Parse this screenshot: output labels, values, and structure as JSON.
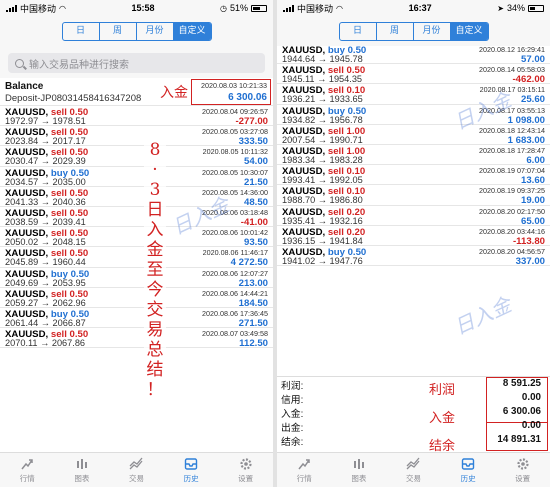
{
  "status_left": {
    "carrier": "中国移动",
    "time": "15:58",
    "battery": "51%",
    "battery_pct": 0.51
  },
  "status_right": {
    "carrier": "中国移动",
    "time": "16:37",
    "battery": "34%",
    "battery_pct": 0.34
  },
  "segments": [
    "日",
    "周",
    "月份",
    "自定义"
  ],
  "active_segment": 3,
  "search_placeholder": "输入交易品种进行搜索",
  "balance": {
    "title": "Balance",
    "deposit_id": "Deposit-JP08031458416347208",
    "datetime": "2020.08.03 10:21:33",
    "amount": "6 300.06"
  },
  "annotations": {
    "deposit": "入金",
    "vertical": [
      "8",
      "·",
      "3",
      "日",
      "入",
      "金",
      "至",
      "今",
      "交",
      "易",
      "总",
      "结",
      "！"
    ],
    "profit": "利润",
    "deposit2": "入金",
    "balance": "结余"
  },
  "left_trades": [
    {
      "symbol": "XAUUSD,",
      "side": "sell",
      "lots": "0.50",
      "open": "1972.97",
      "close": "1978.51",
      "datetime": "2020.08.04 09:26:57",
      "profit": "-277.00"
    },
    {
      "symbol": "XAUUSD,",
      "side": "sell",
      "lots": "0.50",
      "open": "2023.84",
      "close": "2017.17",
      "datetime": "2020.08.05 03:27:08",
      "profit": "333.50"
    },
    {
      "symbol": "XAUUSD,",
      "side": "sell",
      "lots": "0.50",
      "open": "2030.47",
      "close": "2029.39",
      "datetime": "2020.08.05 10:11:32",
      "profit": "54.00"
    },
    {
      "symbol": "XAUUSD,",
      "side": "buy",
      "lots": "0.50",
      "open": "2034.57",
      "close": "2035.00",
      "datetime": "2020.08.05 10:30:07",
      "profit": "21.50"
    },
    {
      "symbol": "XAUUSD,",
      "side": "sell",
      "lots": "0.50",
      "open": "2041.33",
      "close": "2040.36",
      "datetime": "2020.08.05 14:36:00",
      "profit": "48.50"
    },
    {
      "symbol": "XAUUSD,",
      "side": "sell",
      "lots": "0.50",
      "open": "2038.59",
      "close": "2039.41",
      "datetime": "2020.08.06 03:18:48",
      "profit": "-41.00"
    },
    {
      "symbol": "XAUUSD,",
      "side": "sell",
      "lots": "0.50",
      "open": "2050.02",
      "close": "2048.15",
      "datetime": "2020.08.06 10:01:42",
      "profit": "93.50"
    },
    {
      "symbol": "XAUUSD,",
      "side": "sell",
      "lots": "0.50",
      "open": "2045.89",
      "close": "1960.44",
      "datetime": "2020.08.06 11:46:17",
      "profit": "4 272.50"
    },
    {
      "symbol": "XAUUSD,",
      "side": "buy",
      "lots": "0.50",
      "open": "2049.69",
      "close": "2053.95",
      "datetime": "2020.08.06 12:07:27",
      "profit": "213.00"
    },
    {
      "symbol": "XAUUSD,",
      "side": "sell",
      "lots": "0.50",
      "open": "2059.27",
      "close": "2062.96",
      "datetime": "2020.08.06 14:44:21",
      "profit": "184.50"
    },
    {
      "symbol": "XAUUSD,",
      "side": "buy",
      "lots": "0.50",
      "open": "2061.44",
      "close": "2066.87",
      "datetime": "2020.08.06 17:36:45",
      "profit": "271.50"
    },
    {
      "symbol": "XAUUSD,",
      "side": "sell",
      "lots": "0.50",
      "open": "2070.11",
      "close": "2067.86",
      "datetime": "2020.08.07 03:49:58",
      "profit": "112.50"
    }
  ],
  "right_trades": [
    {
      "symbol": "XAUUSD,",
      "side": "buy",
      "lots": "0.50",
      "open": "1944.64",
      "close": "1945.78",
      "datetime": "2020.08.12 16:29:41",
      "profit": "57.00"
    },
    {
      "symbol": "XAUUSD,",
      "side": "sell",
      "lots": "0.50",
      "open": "1945.11",
      "close": "1954.35",
      "datetime": "2020.08.14 05:58:03",
      "profit": "-462.00"
    },
    {
      "symbol": "XAUUSD,",
      "side": "sell",
      "lots": "0.10",
      "open": "1936.21",
      "close": "1933.65",
      "datetime": "2020.08.17 03:15:11",
      "profit": "25.60"
    },
    {
      "symbol": "XAUUSD,",
      "side": "buy",
      "lots": "0.50",
      "open": "1934.82",
      "close": "1956.78",
      "datetime": "2020.08.17 03:55:13",
      "profit": "1 098.00"
    },
    {
      "symbol": "XAUUSD,",
      "side": "sell",
      "lots": "1.00",
      "open": "2007.54",
      "close": "1990.71",
      "datetime": "2020.08.18 12:43:14",
      "profit": "1 683.00"
    },
    {
      "symbol": "XAUUSD,",
      "side": "sell",
      "lots": "1.00",
      "open": "1983.34",
      "close": "1983.28",
      "datetime": "2020.08.18 17:28:47",
      "profit": "6.00"
    },
    {
      "symbol": "XAUUSD,",
      "side": "sell",
      "lots": "0.10",
      "open": "1993.41",
      "close": "1992.05",
      "datetime": "2020.08.19 07:07:04",
      "profit": "13.60"
    },
    {
      "symbol": "XAUUSD,",
      "side": "sell",
      "lots": "0.10",
      "open": "1988.70",
      "close": "1986.80",
      "datetime": "2020.08.19 09:37:25",
      "profit": "19.00"
    },
    {
      "symbol": "XAUUSD,",
      "side": "sell",
      "lots": "0.20",
      "open": "1935.41",
      "close": "1932.16",
      "datetime": "2020.08.20 02:17:50",
      "profit": "65.00"
    },
    {
      "symbol": "XAUUSD,",
      "side": "sell",
      "lots": "0.20",
      "open": "1936.15",
      "close": "1941.84",
      "datetime": "2020.08.20 03:44:16",
      "profit": "-113.80"
    },
    {
      "symbol": "XAUUSD,",
      "side": "buy",
      "lots": "0.50",
      "open": "1941.02",
      "close": "1947.76",
      "datetime": "2020.08.20 04:56:57",
      "profit": "337.00"
    }
  ],
  "summary": [
    {
      "label": "利润:",
      "value": "8 591.25"
    },
    {
      "label": "信用:",
      "value": "0.00"
    },
    {
      "label": "入金:",
      "value": "6 300.06"
    },
    {
      "label": "出金:",
      "value": "0.00"
    },
    {
      "label": "结余:",
      "value": "14 891.31"
    }
  ],
  "tabs": [
    {
      "label": "行情",
      "icon": "quotes-icon"
    },
    {
      "label": "图表",
      "icon": "chart-icon"
    },
    {
      "label": "交易",
      "icon": "trade-icon"
    },
    {
      "label": "历史",
      "icon": "history-icon"
    },
    {
      "label": "设置",
      "icon": "settings-icon"
    }
  ],
  "active_tab": 3,
  "watermark": "日入金",
  "colors": {
    "accent": "#2f80d9",
    "buy": "#1f6fd1",
    "sell": "#d22222",
    "annotation": "#d22222"
  }
}
